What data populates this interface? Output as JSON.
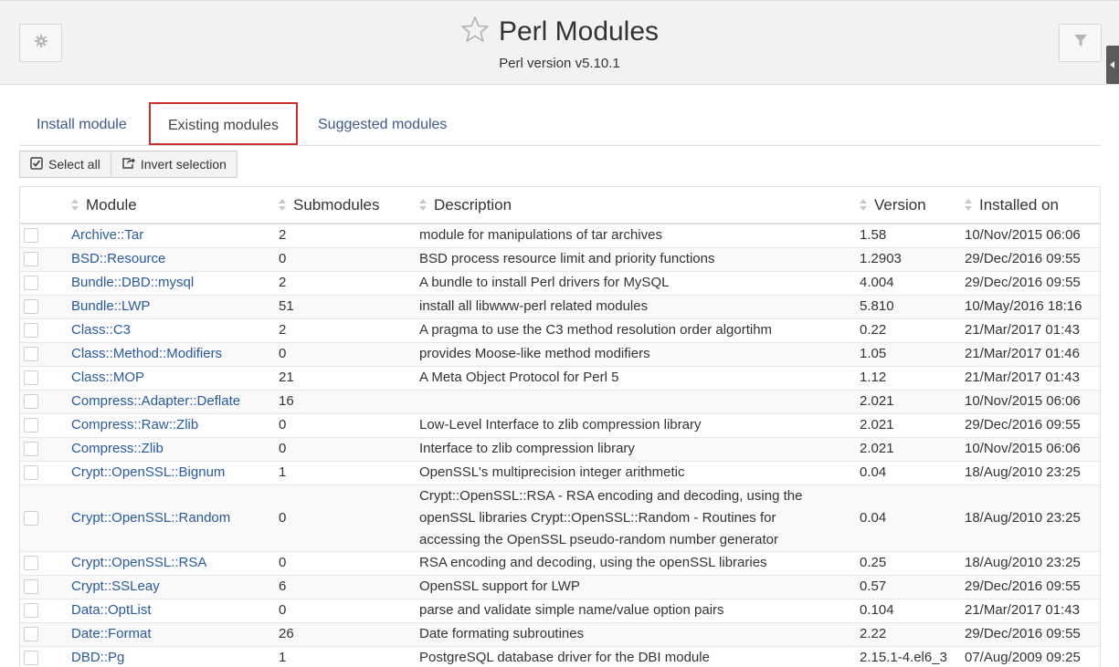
{
  "header": {
    "title": "Perl Modules",
    "subtitle": "Perl version v5.10.1",
    "left_icon": "gear-icon",
    "right_icon": "filter-icon",
    "star_icon": "star-outline-icon"
  },
  "tabs": [
    {
      "label": "Install module",
      "active": false
    },
    {
      "label": "Existing modules",
      "active": true
    },
    {
      "label": "Suggested modules",
      "active": false
    }
  ],
  "toolbar": {
    "select_all": "Select all",
    "invert_selection": "Invert selection"
  },
  "table": {
    "columns": [
      "Module",
      "Submodules",
      "Description",
      "Version",
      "Installed on"
    ],
    "rows": [
      {
        "module": "Archive::Tar",
        "submodules": "2",
        "description": "module for manipulations of tar archives",
        "version": "1.58",
        "installed": "10/Nov/2015 06:06"
      },
      {
        "module": "BSD::Resource",
        "submodules": "0",
        "description": "BSD process resource limit and priority functions",
        "version": "1.2903",
        "installed": "29/Dec/2016 09:55"
      },
      {
        "module": "Bundle::DBD::mysql",
        "submodules": "2",
        "description": "A bundle to install Perl drivers for MySQL",
        "version": "4.004",
        "installed": "29/Dec/2016 09:55"
      },
      {
        "module": "Bundle::LWP",
        "submodules": "51",
        "description": "install all libwww-perl related modules",
        "version": "5.810",
        "installed": "10/May/2016 18:16"
      },
      {
        "module": "Class::C3",
        "submodules": "2",
        "description": "A pragma to use the C3 method resolution order algortihm",
        "version": "0.22",
        "installed": "21/Mar/2017 01:43"
      },
      {
        "module": "Class::Method::Modifiers",
        "submodules": "0",
        "description": "provides Moose-like method modifiers",
        "version": "1.05",
        "installed": "21/Mar/2017 01:46"
      },
      {
        "module": "Class::MOP",
        "submodules": "21",
        "description": "A Meta Object Protocol for Perl 5",
        "version": "1.12",
        "installed": "21/Mar/2017 01:43"
      },
      {
        "module": "Compress::Adapter::Deflate",
        "submodules": "16",
        "description": "",
        "version": "2.021",
        "installed": "10/Nov/2015 06:06"
      },
      {
        "module": "Compress::Raw::Zlib",
        "submodules": "0",
        "description": "Low-Level Interface to zlib compression library",
        "version": "2.021",
        "installed": "29/Dec/2016 09:55"
      },
      {
        "module": "Compress::Zlib",
        "submodules": "0",
        "description": "Interface to zlib compression library",
        "version": "2.021",
        "installed": "10/Nov/2015 06:06"
      },
      {
        "module": "Crypt::OpenSSL::Bignum",
        "submodules": "1",
        "description": "OpenSSL's multiprecision integer arithmetic",
        "version": "0.04",
        "installed": "18/Aug/2010 23:25"
      },
      {
        "module": "Crypt::OpenSSL::Random",
        "submodules": "0",
        "description": "Crypt::OpenSSL::RSA - RSA encoding and decoding, using the openSSL libraries Crypt::OpenSSL::Random - Routines for accessing the OpenSSL pseudo-random number generator",
        "version": "0.04",
        "installed": "18/Aug/2010 23:25"
      },
      {
        "module": "Crypt::OpenSSL::RSA",
        "submodules": "0",
        "description": "RSA encoding and decoding, using the openSSL libraries",
        "version": "0.25",
        "installed": "18/Aug/2010 23:25"
      },
      {
        "module": "Crypt::SSLeay",
        "submodules": "6",
        "description": "OpenSSL support for LWP",
        "version": "0.57",
        "installed": "29/Dec/2016 09:55"
      },
      {
        "module": "Data::OptList",
        "submodules": "0",
        "description": "parse and validate simple name/value option pairs",
        "version": "0.104",
        "installed": "21/Mar/2017 01:43"
      },
      {
        "module": "Date::Format",
        "submodules": "26",
        "description": "Date formating subroutines",
        "version": "2.22",
        "installed": "29/Dec/2016 09:55"
      },
      {
        "module": "DBD::Pg",
        "submodules": "1",
        "description": "PostgreSQL database driver for the DBI module",
        "version": "2.15.1-4.el6_3",
        "installed": "07/Aug/2009 09:25"
      }
    ]
  }
}
